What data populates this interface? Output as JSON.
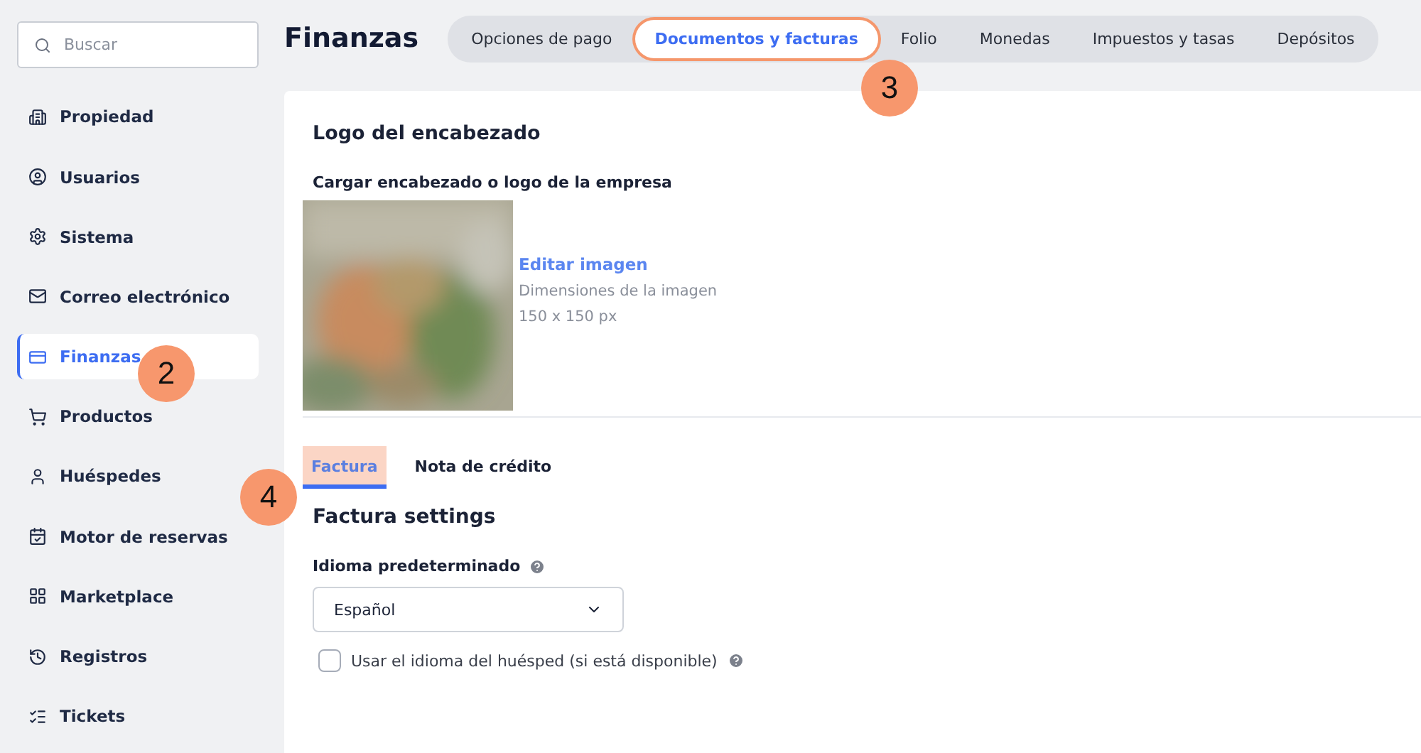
{
  "search": {
    "placeholder": "Buscar"
  },
  "sidebar": {
    "items": [
      {
        "label": "Propiedad",
        "selected": false
      },
      {
        "label": "Usuarios",
        "selected": false
      },
      {
        "label": "Sistema",
        "selected": false
      },
      {
        "label": "Correo electrónico",
        "selected": false
      },
      {
        "label": "Finanzas",
        "selected": true
      },
      {
        "label": "Productos",
        "selected": false
      },
      {
        "label": "Huéspedes",
        "selected": false
      },
      {
        "label": "Motor de reservas",
        "selected": false
      },
      {
        "label": "Marketplace",
        "selected": false
      },
      {
        "label": "Registros",
        "selected": false
      },
      {
        "label": "Tickets",
        "selected": false
      }
    ]
  },
  "page_title": "Finanzas",
  "tabs": [
    {
      "label": "Opciones de pago",
      "selected": false,
      "highlighted": false
    },
    {
      "label": "Documentos y facturas",
      "selected": true,
      "highlighted": true
    },
    {
      "label": "Folio",
      "selected": false,
      "highlighted": false
    },
    {
      "label": "Monedas",
      "selected": false,
      "highlighted": false
    },
    {
      "label": "Impuestos y tasas",
      "selected": false,
      "highlighted": false
    },
    {
      "label": "Depósitos",
      "selected": false,
      "highlighted": false
    }
  ],
  "logo_section": {
    "heading": "Logo del encabezado",
    "upload_label": "Cargar encabezado o logo de la empresa",
    "edit_link": "Editar imagen",
    "dimensions_label": "Dimensiones de la imagen",
    "dimensions": "150 x 150 px"
  },
  "subtabs": [
    {
      "label": "Factura",
      "selected": true,
      "highlighted": true
    },
    {
      "label": "Nota de crédito",
      "selected": false,
      "highlighted": false
    }
  ],
  "settings_heading": "Factura settings",
  "language_field": {
    "label": "Idioma predeterminado",
    "value": "Español"
  },
  "guest_language_checkbox": {
    "label": "Usar el idioma del huésped (si está disponible)",
    "checked": false
  },
  "callouts": [
    {
      "label": "2"
    },
    {
      "label": "3"
    },
    {
      "label": "4"
    }
  ]
}
